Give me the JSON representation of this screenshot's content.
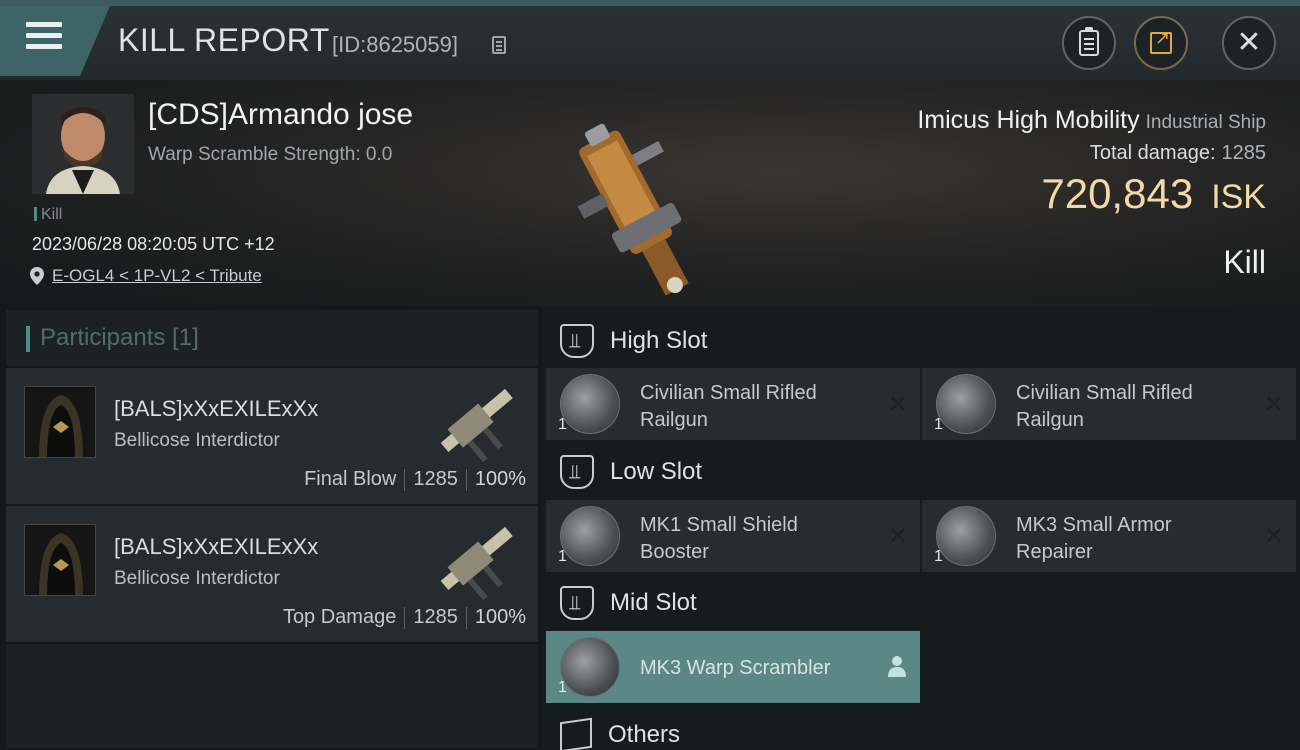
{
  "header": {
    "title": "KILL REPORT",
    "report_id": "[ID:8625059]"
  },
  "victim": {
    "name": "[CDS]Armando jose",
    "warp_scramble": "Warp Scramble Strength: 0.0",
    "kill_tag": "Kill",
    "timestamp": "2023/06/28 08:20:05 UTC +12",
    "location": "E-OGL4 < 1P-VL2 < Tribute",
    "ship_name": "Imicus High Mobility",
    "ship_class": "Industrial Ship",
    "total_damage_label": "Total damage:",
    "total_damage": "1285",
    "isk_value": "720,843",
    "isk_unit": "ISK",
    "result": "Kill"
  },
  "participants": {
    "title": "Participants [1]",
    "items": [
      {
        "name": "[BALS]xXxEXILExXx",
        "ship": "Bellicose Interdictor",
        "role": "Final Blow",
        "damage": "1285",
        "percent": "100%"
      },
      {
        "name": "[BALS]xXxEXILExXx",
        "ship": "Bellicose Interdictor",
        "role": "Top Damage",
        "damage": "1285",
        "percent": "100%"
      }
    ]
  },
  "fitting": {
    "high_slot": "High Slot",
    "low_slot": "Low Slot",
    "mid_slot": "Mid Slot",
    "others": "Others",
    "high": [
      {
        "qty": "1",
        "line1": "Civilian Small Rifled",
        "line2": "Railgun"
      },
      {
        "qty": "1",
        "line1": "Civilian Small Rifled",
        "line2": "Railgun"
      }
    ],
    "low": [
      {
        "qty": "1",
        "line1": "MK1 Small Shield",
        "line2": "Booster"
      },
      {
        "qty": "1",
        "line1": "MK3 Small Armor",
        "line2": "Repairer"
      }
    ],
    "mid": [
      {
        "qty": "1",
        "line1": "MK3 Warp Scrambler",
        "line2": ""
      }
    ]
  },
  "icons": {
    "close": "✕",
    "destroyed": "✕"
  },
  "colors": {
    "accent": "#4f8f87",
    "isk": "#f2d9a6",
    "highlight": "#5b8784"
  }
}
